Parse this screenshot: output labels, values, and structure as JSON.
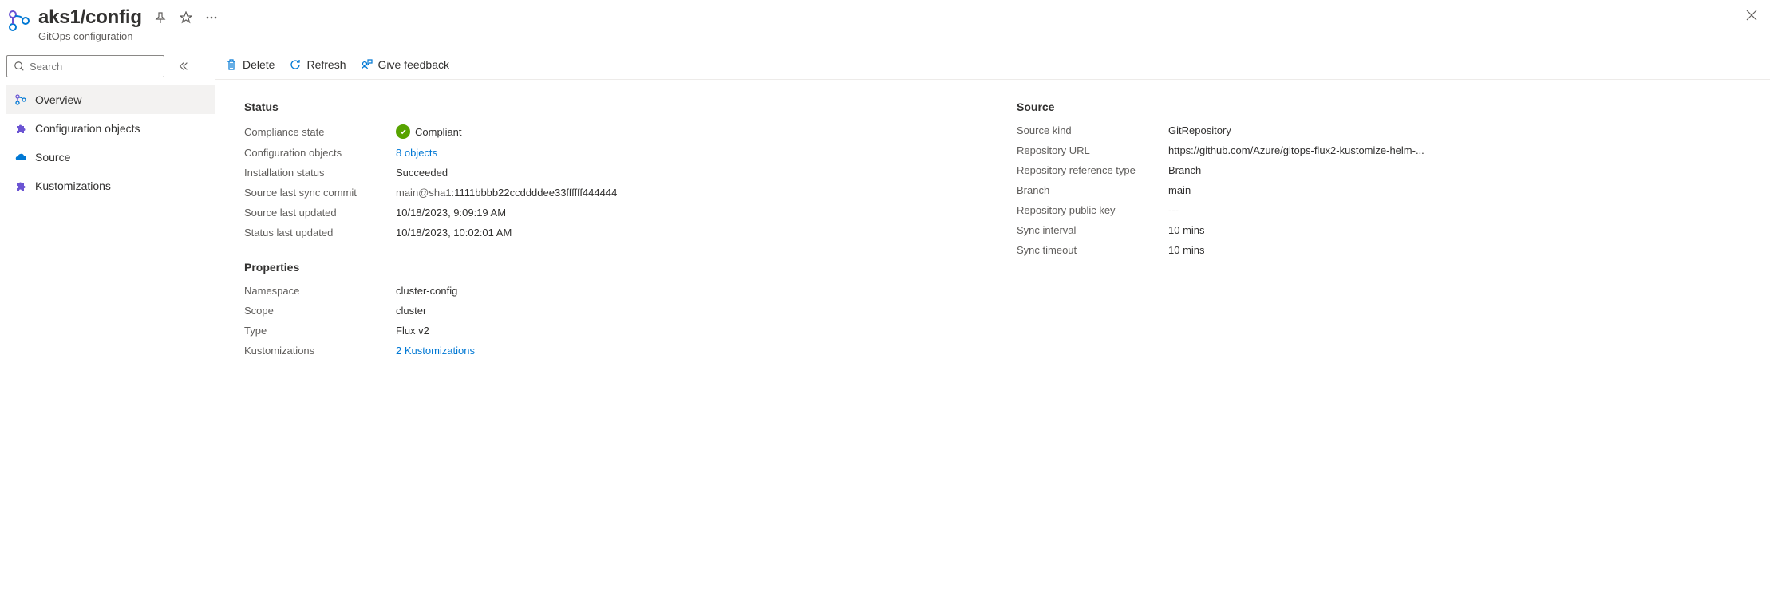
{
  "header": {
    "title": "aks1/config",
    "subtitle": "GitOps configuration"
  },
  "search": {
    "placeholder": "Search"
  },
  "sidebar": {
    "items": [
      {
        "label": "Overview"
      },
      {
        "label": "Configuration objects"
      },
      {
        "label": "Source"
      },
      {
        "label": "Kustomizations"
      }
    ]
  },
  "toolbar": {
    "delete": "Delete",
    "refresh": "Refresh",
    "feedback": "Give feedback"
  },
  "status": {
    "title": "Status",
    "compliance_state_label": "Compliance state",
    "compliance_state_value": "Compliant",
    "config_objects_label": "Configuration objects",
    "config_objects_value": "8 objects",
    "install_status_label": "Installation status",
    "install_status_value": "Succeeded",
    "last_sync_commit_label": "Source last sync commit",
    "last_sync_commit_prefix": "main@sha1:",
    "last_sync_commit_hash": "1111bbbb22ccddddee33ffffff444444",
    "source_last_updated_label": "Source last updated",
    "source_last_updated_value": "10/18/2023, 9:09:19 AM",
    "status_last_updated_label": "Status last updated",
    "status_last_updated_value": "10/18/2023, 10:02:01 AM"
  },
  "properties": {
    "title": "Properties",
    "namespace_label": "Namespace",
    "namespace_value": "cluster-config",
    "scope_label": "Scope",
    "scope_value": "cluster",
    "type_label": "Type",
    "type_value": "Flux v2",
    "kustomizations_label": "Kustomizations",
    "kustomizations_value": "2 Kustomizations"
  },
  "source": {
    "title": "Source",
    "source_kind_label": "Source kind",
    "source_kind_value": "GitRepository",
    "repo_url_label": "Repository URL",
    "repo_url_value": "https://github.com/Azure/gitops-flux2-kustomize-helm-...",
    "repo_ref_type_label": "Repository reference type",
    "repo_ref_type_value": "Branch",
    "branch_label": "Branch",
    "branch_value": "main",
    "public_key_label": "Repository public key",
    "public_key_value": "---",
    "sync_interval_label": "Sync interval",
    "sync_interval_value": "10 mins",
    "sync_timeout_label": "Sync timeout",
    "sync_timeout_value": "10 mins"
  }
}
